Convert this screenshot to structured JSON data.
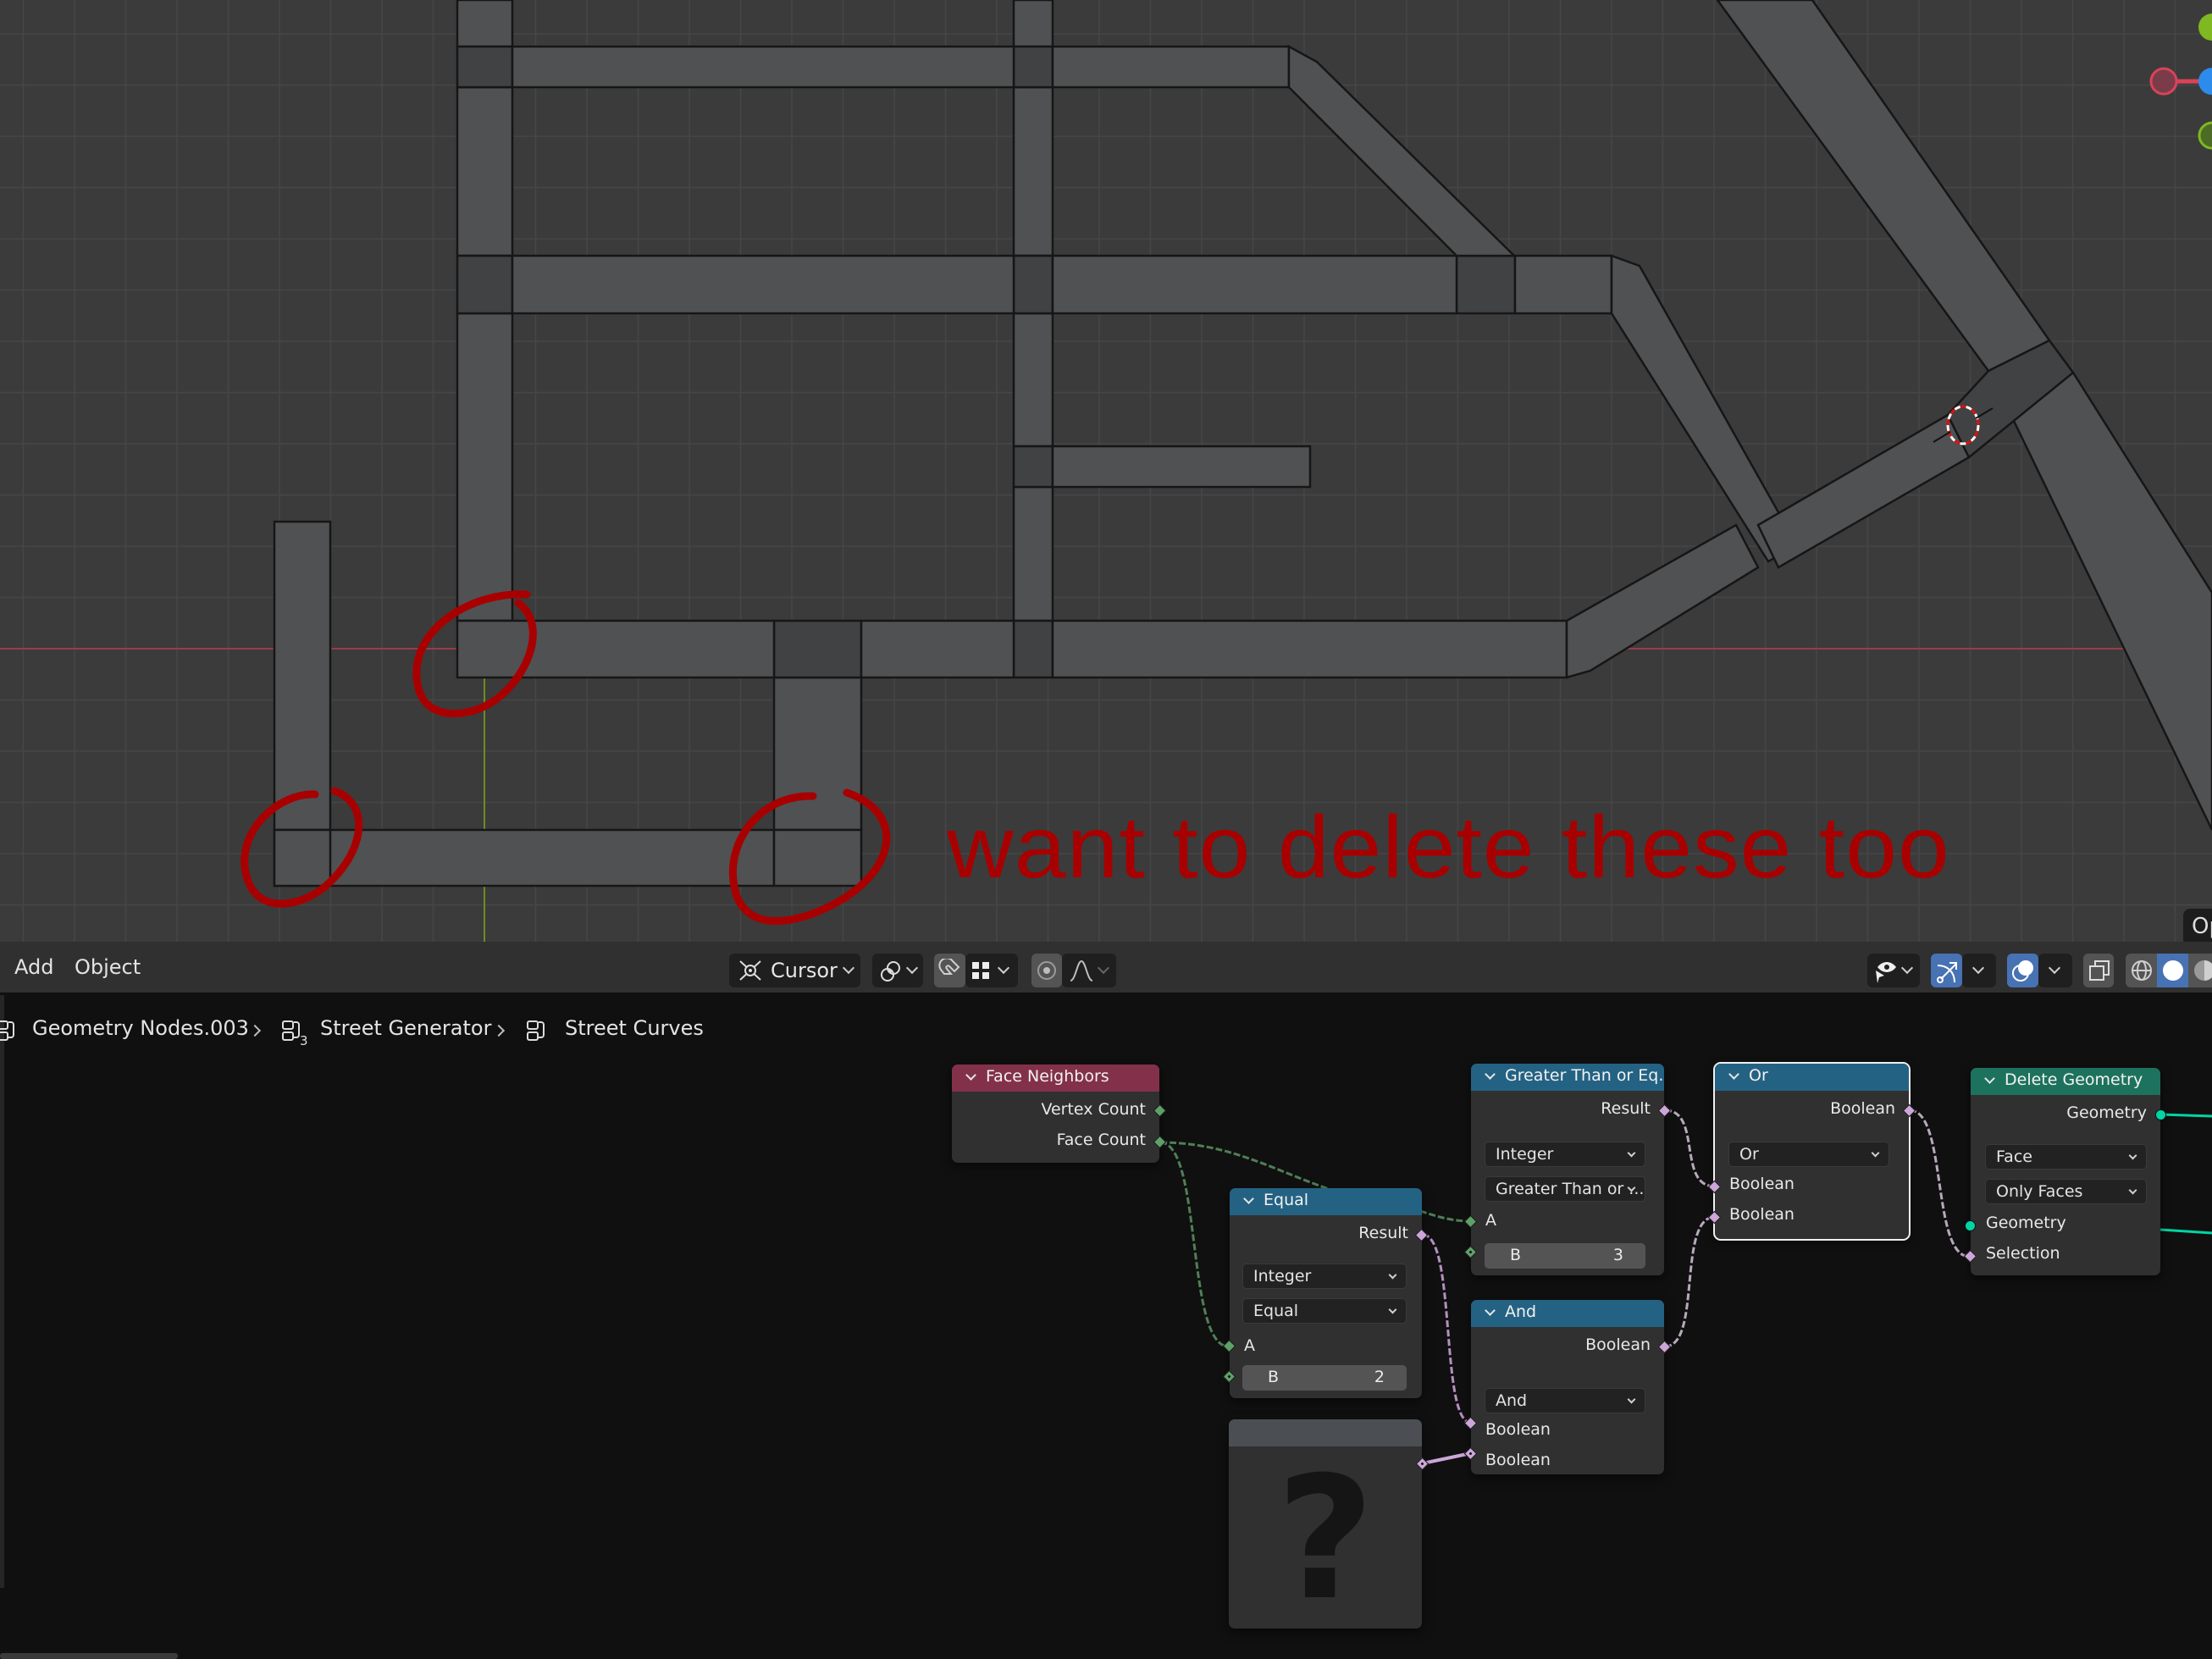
{
  "viewport": {
    "annotation_text": "want to delete these too",
    "annotation_color": "#a80000",
    "overlay_button_label": "Op",
    "axis_gizmo": {
      "x_color": "#d9435a",
      "y_color": "#7fb820",
      "z_color": "#2d8ceb"
    }
  },
  "viewport_header": {
    "menus": [
      {
        "label": "Add"
      },
      {
        "label": "Object"
      }
    ],
    "pivot": {
      "icon": "transform-pivot-cursor-icon",
      "label": "Cursor"
    },
    "transform_orientation_icon": "linked-rings-icon",
    "snap": {
      "icon": "magnet-icon",
      "target_icon": "snap-grid-icon",
      "active": true
    },
    "proportional_edit": {
      "icon": "proportional-edit-icon",
      "falloff_icon": "falloff-curve-icon",
      "active": true
    },
    "visibility_icon": "eye-selectability-icon",
    "gizmo_icon": "gizmo-icon",
    "overlays_icon": "overlays-icon",
    "xray_icon": "xray-icon",
    "shading": [
      {
        "name": "wireframe"
      },
      {
        "name": "solid",
        "active": true
      },
      {
        "name": "material"
      }
    ]
  },
  "breadcrumb": [
    {
      "label": "Geometry Nodes.003",
      "icon": "node-tree-icon"
    },
    {
      "label": "Street Generator",
      "icon": "node-tree-icon",
      "users": "3"
    },
    {
      "label": "Street Curves",
      "icon": "node-tree-icon"
    }
  ],
  "nodes": {
    "face_neighbors": {
      "title": "Face Neighbors",
      "color": "#83314a",
      "outputs": [
        "Vertex Count",
        "Face Count"
      ]
    },
    "equal": {
      "title": "Equal",
      "color": "#246283",
      "output": "Result",
      "data_type": "Integer",
      "operation": "Equal",
      "input_a": "A",
      "input_b": {
        "label": "B",
        "value": "2"
      }
    },
    "greater_equal": {
      "title": "Greater Than or Eq...",
      "color": "#246283",
      "output": "Result",
      "data_type": "Integer",
      "operation": "Greater Than or ...",
      "input_a": "A",
      "input_b": {
        "label": "B",
        "value": "3"
      }
    },
    "and": {
      "title": "And",
      "color": "#246283",
      "output": "Boolean",
      "operation": "And",
      "inputs": [
        "Boolean",
        "Boolean"
      ]
    },
    "or": {
      "title": "Or",
      "color": "#246283",
      "output": "Boolean",
      "operation": "Or",
      "inputs": [
        "Boolean",
        "Boolean"
      ],
      "selected": true
    },
    "delete_geometry": {
      "title": "Delete Geometry",
      "color": "#1d725e",
      "output": "Geometry",
      "domain": "Face",
      "mode": "Only Faces",
      "inputs": [
        "Geometry",
        "Selection"
      ]
    },
    "missing": {
      "title": "",
      "glyph": "?"
    }
  }
}
